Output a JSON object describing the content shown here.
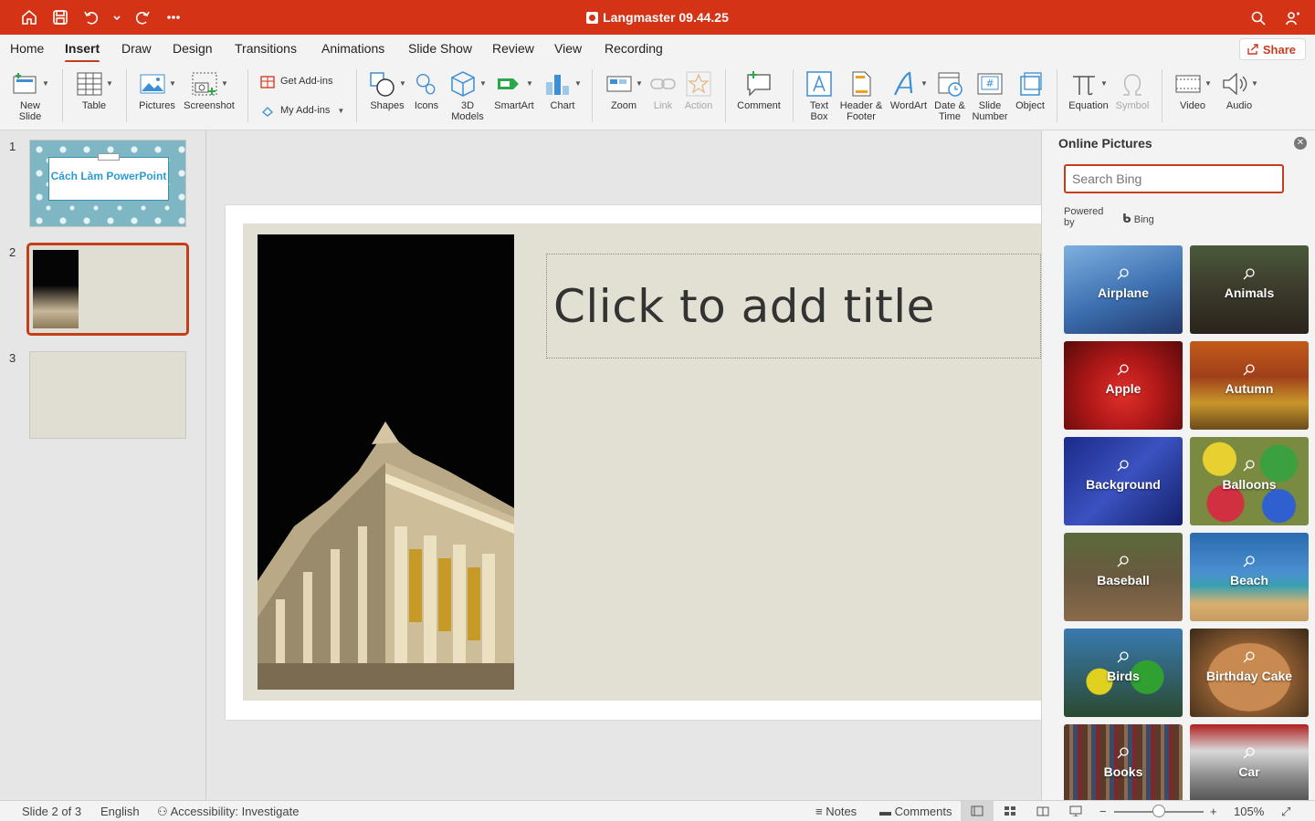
{
  "titlebar": {
    "title": "Langmaster 09.44.25"
  },
  "tabs": [
    "Home",
    "Insert",
    "Draw",
    "Design",
    "Transitions",
    "Animations",
    "Slide Show",
    "Review",
    "View",
    "Recording"
  ],
  "active_tab": "Insert",
  "share_label": "Share",
  "toolbar": {
    "new_slide": "New\nSlide",
    "table": "Table",
    "pictures": "Pictures",
    "screenshot": "Screenshot",
    "get_addins": "Get Add-ins",
    "my_addins": "My Add-ins",
    "shapes": "Shapes",
    "icons": "Icons",
    "models3d": "3D\nModels",
    "smartart": "SmartArt",
    "chart": "Chart",
    "zoom": "Zoom",
    "link": "Link",
    "action": "Action",
    "comment": "Comment",
    "textbox": "Text\nBox",
    "header_footer": "Header &\nFooter",
    "wordart": "WordArt",
    "date_time": "Date &\nTime",
    "slide_number": "Slide\nNumber",
    "object": "Object",
    "equation": "Equation",
    "symbol": "Symbol",
    "video": "Video",
    "audio": "Audio"
  },
  "slides": {
    "numbers": [
      "1",
      "2",
      "3"
    ],
    "slide1_title": "Cách Làm PowerPoint"
  },
  "editor": {
    "title_placeholder": "Click to add title"
  },
  "pane": {
    "title": "Online Pictures",
    "search_placeholder": "Search Bing",
    "powered_by": "Powered by",
    "bing": "Bing",
    "categories": [
      "Airplane",
      "Animals",
      "Apple",
      "Autumn",
      "Background",
      "Balloons",
      "Baseball",
      "Beach",
      "Birds",
      "Birthday Cake",
      "Books",
      "Car"
    ]
  },
  "status": {
    "slide_of": "Slide 2 of 3",
    "language": "English",
    "accessibility": "Accessibility: Investigate",
    "notes": "Notes",
    "comments": "Comments",
    "zoom": "105%"
  },
  "colors": {
    "accent": "#c43e1c",
    "titlebar": "#d43315"
  }
}
